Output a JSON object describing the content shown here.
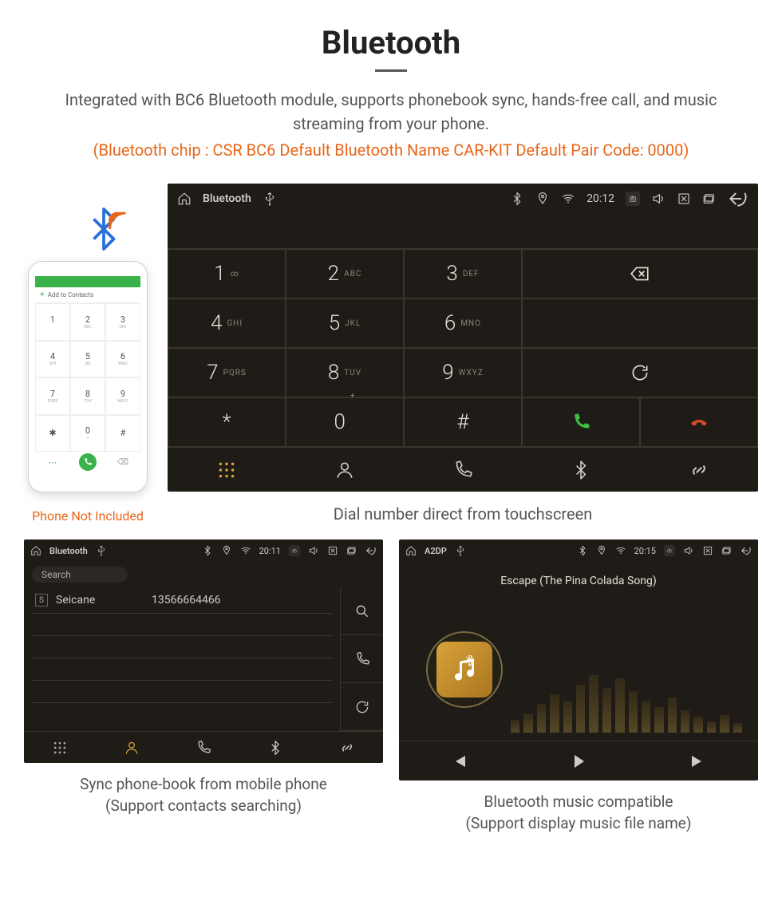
{
  "header": {
    "title": "Bluetooth",
    "description": "Integrated with BC6 Bluetooth module, supports phonebook sync, hands-free call, and music streaming from your phone.",
    "specs": "(Bluetooth chip : CSR BC6     Default Bluetooth Name CAR-KIT     Default Pair Code: 0000)"
  },
  "phone": {
    "add_contacts": "Add to Contacts",
    "caption": "Phone Not Included"
  },
  "dialer": {
    "status": {
      "title": "Bluetooth",
      "time": "20:12"
    },
    "keys": [
      {
        "num": "1",
        "letters": "∞"
      },
      {
        "num": "2",
        "letters": "ABC"
      },
      {
        "num": "3",
        "letters": "DEF"
      },
      {
        "num": "4",
        "letters": "GHI"
      },
      {
        "num": "5",
        "letters": "JKL"
      },
      {
        "num": "6",
        "letters": "MNO"
      },
      {
        "num": "7",
        "letters": "PQRS"
      },
      {
        "num": "8",
        "letters": "TUV"
      },
      {
        "num": "9",
        "letters": "WXYZ"
      },
      {
        "num": "*",
        "letters": ""
      },
      {
        "num": "0",
        "letters": "+"
      },
      {
        "num": "#",
        "letters": ""
      }
    ],
    "caption": "Dial number direct from touchscreen"
  },
  "phonebook": {
    "status": {
      "title": "Bluetooth",
      "time": "20:11"
    },
    "search_placeholder": "Search",
    "contact": {
      "initial": "S",
      "name": "Seicane",
      "number": "13566664466"
    },
    "caption_line1": "Sync phone-book from mobile phone",
    "caption_line2": "(Support contacts searching)"
  },
  "music": {
    "status": {
      "title": "A2DP",
      "time": "20:15"
    },
    "track": "Escape (The Pina Colada Song)",
    "caption_line1": "Bluetooth music compatible",
    "caption_line2": "(Support display music file name)"
  }
}
